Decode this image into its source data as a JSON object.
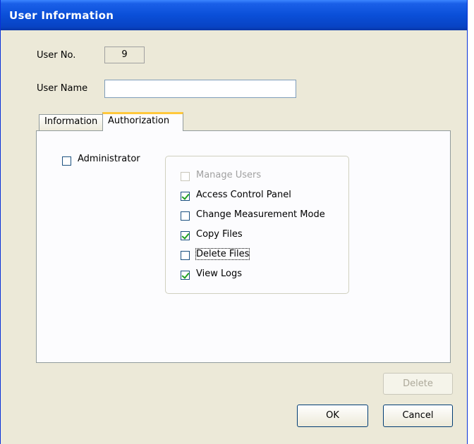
{
  "window": {
    "title": "User Information"
  },
  "form": {
    "user_no_label": "User No.",
    "user_no_value": "9",
    "user_name_label": "User Name",
    "user_name_value": ""
  },
  "tabs": [
    {
      "label": "Information",
      "active": false
    },
    {
      "label": "Authorization",
      "active": true
    }
  ],
  "authorization": {
    "administrator": {
      "label": "Administrator",
      "checked": false
    },
    "permissions": [
      {
        "label": "Manage Users",
        "checked": false,
        "disabled": true
      },
      {
        "label": "Access Control Panel",
        "checked": true,
        "disabled": false
      },
      {
        "label": "Change Measurement Mode",
        "checked": false,
        "disabled": false
      },
      {
        "label": "Copy Files",
        "checked": true,
        "disabled": false
      },
      {
        "label": "Delete Files",
        "checked": false,
        "disabled": false,
        "focused": true
      },
      {
        "label": "View Logs",
        "checked": true,
        "disabled": false
      }
    ]
  },
  "buttons": {
    "delete_label": "Delete",
    "delete_disabled": true,
    "ok_label": "OK",
    "cancel_label": "Cancel"
  },
  "colors": {
    "titlebar": "#0a4fd8",
    "dialog_bg": "#ece9d8",
    "check_mark": "#21a121",
    "tab_highlight": "#ffc83c"
  }
}
